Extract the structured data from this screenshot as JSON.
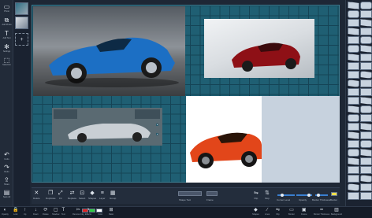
{
  "left_rail": {
    "items": [
      {
        "label": "Photo",
        "icon": "camera-icon"
      },
      {
        "label": "Add Photo",
        "icon": "photo-stack-icon"
      },
      {
        "label": "Add Text",
        "icon": "text-icon"
      },
      {
        "label": "Settings",
        "icon": "gear-icon"
      },
      {
        "label": "Selection",
        "icon": "selection-icon"
      },
      {
        "label": "Undo",
        "icon": "undo-icon"
      },
      {
        "label": "Redo",
        "icon": "redo-icon"
      },
      {
        "label": "Share",
        "icon": "share-icon"
      },
      {
        "label": "Save All",
        "icon": "save-icon"
      }
    ]
  },
  "thumbs": {
    "add_glyph": "+"
  },
  "canvas": {
    "replace_photo_glyph": "▣"
  },
  "edit_bar": {
    "buttons": [
      {
        "label": "Delete",
        "glyph": "✕"
      },
      {
        "label": "Duplicate",
        "glyph": "❐"
      },
      {
        "label": "Fit",
        "glyph": "⤢"
      },
      {
        "label": "Replace",
        "glyph": "⇄"
      },
      {
        "label": "Select",
        "glyph": "⊡"
      },
      {
        "label": "Shapes",
        "glyph": "◆"
      },
      {
        "label": "Layer",
        "glyph": "≡"
      },
      {
        "label": "Group",
        "glyph": "▦"
      }
    ],
    "shape_tool_label": "Shape Tool",
    "frame_label": "Frame",
    "flip_label": "Flip",
    "flop_label": "Flop",
    "corner_label": "Corner Level",
    "opacity_label": "Opacity",
    "border_label": "Border Thickness",
    "border_color_label": "Border",
    "accent_color": "#3a7fd0",
    "border_color": "#f2e04a"
  },
  "status_bar": {
    "left_buttons": [
      {
        "label": "Opacity",
        "glyph": "◐"
      },
      {
        "label": "Lock",
        "glyph": "🔒"
      },
      {
        "label": "Up",
        "glyph": "↑"
      },
      {
        "label": "Down",
        "glyph": "↓"
      },
      {
        "label": "Rotate",
        "glyph": "⟳"
      },
      {
        "label": "Shadow",
        "glyph": "▢"
      },
      {
        "label": "Text",
        "glyph": "T"
      },
      {
        "label": "Remove bkg",
        "glyph": "✂"
      },
      {
        "label": "Effects",
        "glyph": "✦"
      },
      {
        "label": "Color",
        "glyph": "●"
      },
      {
        "label": "Ratio",
        "glyph": "⊞"
      }
    ],
    "right_buttons": [
      {
        "label": "Shapes",
        "glyph": "◆"
      },
      {
        "label": "Lines",
        "glyph": "∕"
      },
      {
        "label": "Flip",
        "glyph": "⇋"
      },
      {
        "label": "Border",
        "glyph": "▭"
      },
      {
        "label": "Frame",
        "glyph": "▣"
      },
      {
        "label": "Border Thickness",
        "glyph": "━"
      },
      {
        "label": "Background",
        "glyph": "▥"
      }
    ],
    "swatches": [
      "#e02020",
      "#2ecc40",
      "#ffffff"
    ]
  }
}
